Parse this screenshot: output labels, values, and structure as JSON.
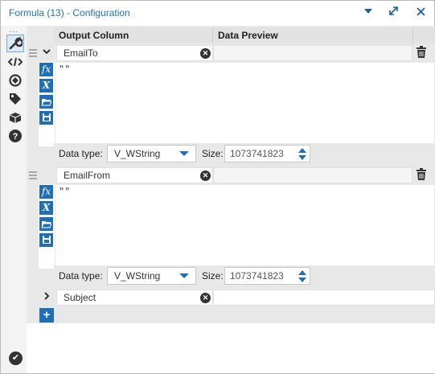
{
  "window": {
    "title": "Formula (13) - Configuration",
    "controls": [
      "dropdown-icon",
      "restore-icon",
      "close-icon"
    ]
  },
  "sidebar": {
    "dots": "...",
    "items": [
      {
        "name": "configuration-icon",
        "active": true
      },
      {
        "name": "xml-icon"
      },
      {
        "name": "connections-icon"
      },
      {
        "name": "annotation-icon"
      },
      {
        "name": "metadata-icon"
      },
      {
        "name": "help-icon"
      }
    ]
  },
  "grid": {
    "headers": {
      "output_column": "Output Column",
      "data_preview": "Data Preview"
    }
  },
  "formulas": [
    {
      "name": "EmailTo",
      "expression": "\"\"",
      "expanded": true,
      "data_type_label": "Data type:",
      "data_type": "V_WString",
      "size_label": "Size:",
      "size": "1073741823"
    },
    {
      "name": "EmailFrom",
      "expression": "\"\"",
      "expanded": true,
      "data_type_label": "Data type:",
      "data_type": "V_WString",
      "size_label": "Size:",
      "size": "1073741823"
    },
    {
      "name": "Subject",
      "expanded": false
    }
  ],
  "tools": {
    "fx": "fx",
    "variables": "X"
  },
  "add_button": "+",
  "colors": {
    "accent": "#1f6fb8",
    "title": "#1f6fb8",
    "panel": "#e8e8e8"
  }
}
